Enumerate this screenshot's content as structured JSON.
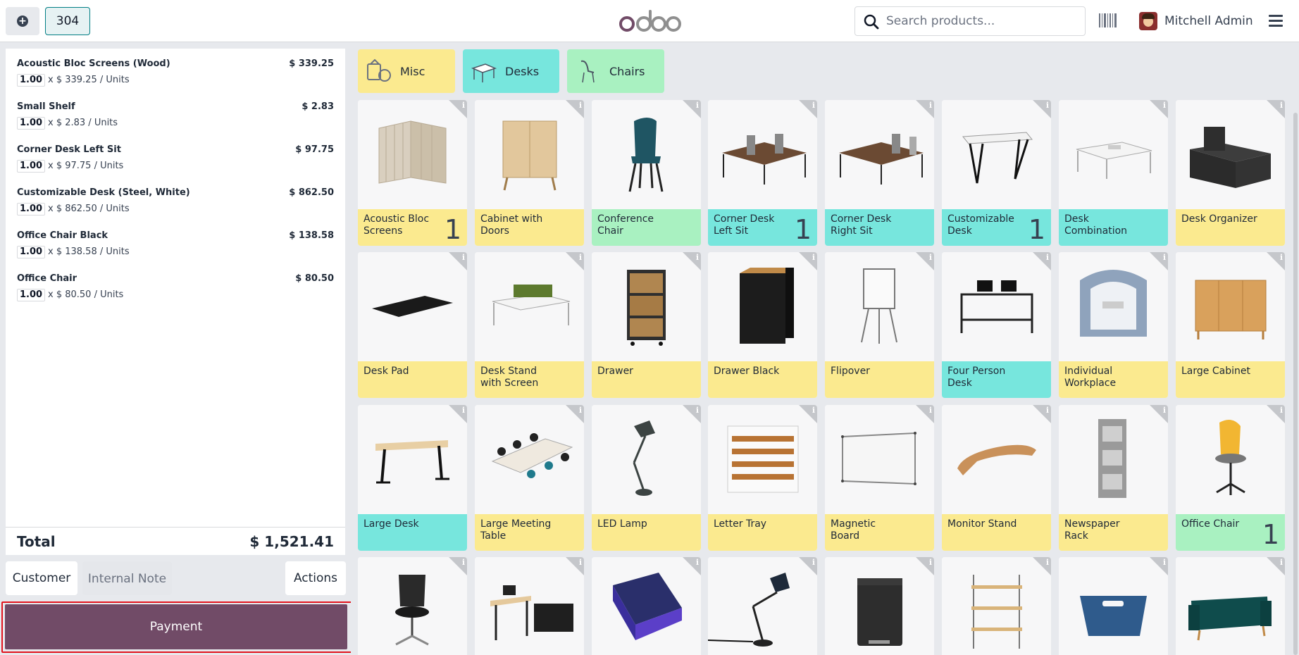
{
  "topbar": {
    "order_number": "304",
    "search_placeholder": "Search products...",
    "user_name": "Mitchell Admin",
    "logo_text": "odoo"
  },
  "orderlines": [
    {
      "name": "Acoustic Bloc Screens (Wood)",
      "price": "$ 339.25",
      "qty": "1.00",
      "unit_price": "x $ 339.25 / Units"
    },
    {
      "name": "Small Shelf",
      "price": "$ 2.83",
      "qty": "1.00",
      "unit_price": "x $ 2.83 / Units"
    },
    {
      "name": "Corner Desk Left Sit",
      "price": "$ 97.75",
      "qty": "1.00",
      "unit_price": "x $ 97.75 / Units"
    },
    {
      "name": "Customizable Desk (Steel, White)",
      "price": "$ 862.50",
      "qty": "1.00",
      "unit_price": "x $ 862.50 / Units"
    },
    {
      "name": "Office Chair Black",
      "price": "$ 138.58",
      "qty": "1.00",
      "unit_price": "x $ 138.58 / Units"
    },
    {
      "name": "Office Chair",
      "price": "$ 80.50",
      "qty": "1.00",
      "unit_price": "x $ 80.50 / Units"
    }
  ],
  "total": {
    "label": "Total",
    "value": "$ 1,521.41"
  },
  "controls": {
    "customer": "Customer",
    "internal_note": "Internal Note",
    "actions": "Actions",
    "payment": "Payment"
  },
  "categories": [
    {
      "label": "Misc",
      "color": "#fbea8f"
    },
    {
      "label": "Desks",
      "color": "#77e6dd"
    },
    {
      "label": "Chairs",
      "color": "#a9f1c1"
    }
  ],
  "products": [
    {
      "name": "Acoustic Bloc Screens",
      "color": "yellow",
      "qty": "1",
      "icon": "acoustic-screen-icon"
    },
    {
      "name": "Cabinet with Doors",
      "color": "yellow",
      "qty": "",
      "icon": "cabinet-icon"
    },
    {
      "name": "Conference Chair",
      "color": "green",
      "qty": "",
      "icon": "chair-icon"
    },
    {
      "name": "Corner Desk Left Sit",
      "color": "teal",
      "qty": "1",
      "icon": "corner-desk-icon"
    },
    {
      "name": "Corner Desk Right Sit",
      "color": "teal",
      "qty": "",
      "icon": "corner-desk-icon"
    },
    {
      "name": "Customizable Desk",
      "color": "teal",
      "qty": "1",
      "icon": "table-icon"
    },
    {
      "name": "Desk Combination",
      "color": "teal",
      "qty": "",
      "icon": "desk-combination-icon"
    },
    {
      "name": "Desk Organizer",
      "color": "yellow",
      "qty": "",
      "icon": "organizer-icon"
    },
    {
      "name": "Desk Pad",
      "color": "yellow",
      "qty": "",
      "icon": "desk-pad-icon"
    },
    {
      "name": "Desk Stand with Screen",
      "color": "yellow",
      "qty": "",
      "icon": "desk-stand-icon"
    },
    {
      "name": "Drawer",
      "color": "yellow",
      "qty": "",
      "icon": "drawer-icon"
    },
    {
      "name": "Drawer Black",
      "color": "yellow",
      "qty": "",
      "icon": "drawer-black-icon"
    },
    {
      "name": "Flipover",
      "color": "yellow",
      "qty": "",
      "icon": "flipover-icon"
    },
    {
      "name": "Four Person Desk",
      "color": "teal",
      "qty": "",
      "icon": "four-person-desk-icon"
    },
    {
      "name": "Individual Workplace",
      "color": "yellow",
      "qty": "",
      "icon": "workplace-pod-icon"
    },
    {
      "name": "Large Cabinet",
      "color": "yellow",
      "qty": "",
      "icon": "large-cabinet-icon"
    },
    {
      "name": "Large Desk",
      "color": "teal",
      "qty": "",
      "icon": "large-desk-icon"
    },
    {
      "name": "Large Meeting Table",
      "color": "yellow",
      "qty": "",
      "icon": "meeting-table-icon"
    },
    {
      "name": "LED Lamp",
      "color": "yellow",
      "qty": "",
      "icon": "lamp-icon"
    },
    {
      "name": "Letter Tray",
      "color": "yellow",
      "qty": "",
      "icon": "letter-tray-icon"
    },
    {
      "name": "Magnetic Board",
      "color": "yellow",
      "qty": "",
      "icon": "whiteboard-icon"
    },
    {
      "name": "Monitor Stand",
      "color": "yellow",
      "qty": "",
      "icon": "monitor-stand-icon"
    },
    {
      "name": "Newspaper Rack",
      "color": "yellow",
      "qty": "",
      "icon": "newspaper-rack-icon"
    },
    {
      "name": "Office Chair",
      "color": "green",
      "qty": "1",
      "icon": "office-chair-yellow-icon"
    },
    {
      "name": "",
      "color": "white",
      "qty": "",
      "icon": "office-chair-black-icon"
    },
    {
      "name": "",
      "color": "white",
      "qty": "",
      "icon": "standing-desk-icon"
    },
    {
      "name": "",
      "color": "white",
      "qty": "",
      "icon": "software-box-icon"
    },
    {
      "name": "",
      "color": "white",
      "qty": "",
      "icon": "desk-lamp-icon"
    },
    {
      "name": "",
      "color": "white",
      "qty": "",
      "icon": "bin-icon"
    },
    {
      "name": "",
      "color": "white",
      "qty": "",
      "icon": "shelf-icon"
    },
    {
      "name": "",
      "color": "white",
      "qty": "",
      "icon": "basket-icon"
    },
    {
      "name": "",
      "color": "white",
      "qty": "",
      "icon": "sofa-icon"
    }
  ]
}
